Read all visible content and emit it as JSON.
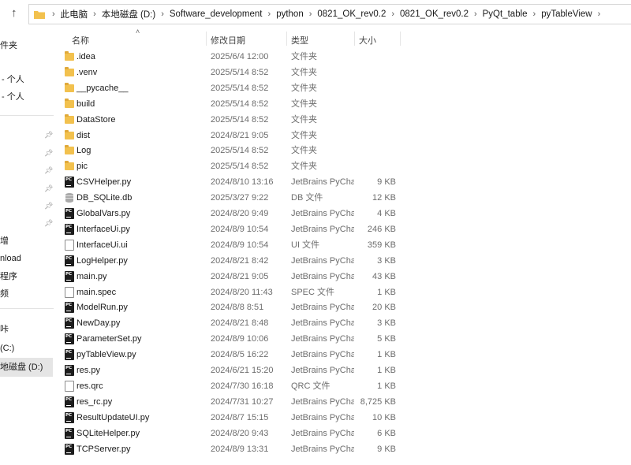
{
  "address_bar": {
    "crumbs": [
      "此电脑",
      "本地磁盘 (D:)",
      "Software_development",
      "python",
      "0821_OK_rev0.2",
      "0821_OK_rev0.2",
      "PyQt_table",
      "pyTableView"
    ]
  },
  "sidebar": {
    "items": [
      {
        "label": "件夹"
      },
      {
        "label": "- 个人"
      },
      {
        "label": "- 个人"
      },
      {
        "label": "增"
      },
      {
        "label": "nload"
      },
      {
        "label": "程序"
      },
      {
        "label": "频"
      },
      {
        "label": "咔"
      },
      {
        "label": "(C:)"
      },
      {
        "label": "地磁盘 (D:)"
      }
    ]
  },
  "columns": {
    "name": "名称",
    "date": "修改日期",
    "type": "类型",
    "size": "大小"
  },
  "files": [
    {
      "name": ".idea",
      "date": "2025/6/4 12:00",
      "type": "文件夹",
      "size": "",
      "icon": "folder"
    },
    {
      "name": ".venv",
      "date": "2025/5/14 8:52",
      "type": "文件夹",
      "size": "",
      "icon": "folder"
    },
    {
      "name": "__pycache__",
      "date": "2025/5/14 8:52",
      "type": "文件夹",
      "size": "",
      "icon": "folder"
    },
    {
      "name": "build",
      "date": "2025/5/14 8:52",
      "type": "文件夹",
      "size": "",
      "icon": "folder"
    },
    {
      "name": "DataStore",
      "date": "2025/5/14 8:52",
      "type": "文件夹",
      "size": "",
      "icon": "folder"
    },
    {
      "name": "dist",
      "date": "2024/8/21 9:05",
      "type": "文件夹",
      "size": "",
      "icon": "folder"
    },
    {
      "name": "Log",
      "date": "2025/5/14 8:52",
      "type": "文件夹",
      "size": "",
      "icon": "folder"
    },
    {
      "name": "pic",
      "date": "2025/5/14 8:52",
      "type": "文件夹",
      "size": "",
      "icon": "folder"
    },
    {
      "name": "CSVHelper.py",
      "date": "2024/8/10 13:16",
      "type": "JetBrains PyChar...",
      "size": "9 KB",
      "icon": "pycharm-file"
    },
    {
      "name": "DB_SQLite.db",
      "date": "2025/3/27 9:22",
      "type": "DB 文件",
      "size": "12 KB",
      "icon": "database-file"
    },
    {
      "name": "GlobalVars.py",
      "date": "2024/8/20 9:49",
      "type": "JetBrains PyChar...",
      "size": "4 KB",
      "icon": "pycharm-file"
    },
    {
      "name": "InterfaceUi.py",
      "date": "2024/8/9 10:54",
      "type": "JetBrains PyChar...",
      "size": "246 KB",
      "icon": "pycharm-file"
    },
    {
      "name": "InterfaceUi.ui",
      "date": "2024/8/9 10:54",
      "type": "UI 文件",
      "size": "359 KB",
      "icon": "generic-file"
    },
    {
      "name": "LogHelper.py",
      "date": "2024/8/21 8:42",
      "type": "JetBrains PyChar...",
      "size": "3 KB",
      "icon": "pycharm-file"
    },
    {
      "name": "main.py",
      "date": "2024/8/21 9:05",
      "type": "JetBrains PyChar...",
      "size": "43 KB",
      "icon": "pycharm-file"
    },
    {
      "name": "main.spec",
      "date": "2024/8/20 11:43",
      "type": "SPEC 文件",
      "size": "1 KB",
      "icon": "generic-file"
    },
    {
      "name": "ModelRun.py",
      "date": "2024/8/8 8:51",
      "type": "JetBrains PyChar...",
      "size": "20 KB",
      "icon": "pycharm-file"
    },
    {
      "name": "NewDay.py",
      "date": "2024/8/21 8:48",
      "type": "JetBrains PyChar...",
      "size": "3 KB",
      "icon": "pycharm-file"
    },
    {
      "name": "ParameterSet.py",
      "date": "2024/8/9 10:06",
      "type": "JetBrains PyChar...",
      "size": "5 KB",
      "icon": "pycharm-file"
    },
    {
      "name": "pyTableView.py",
      "date": "2024/8/5 16:22",
      "type": "JetBrains PyChar...",
      "size": "1 KB",
      "icon": "pycharm-file"
    },
    {
      "name": "res.py",
      "date": "2024/6/21 15:20",
      "type": "JetBrains PyChar...",
      "size": "1 KB",
      "icon": "pycharm-file"
    },
    {
      "name": "res.qrc",
      "date": "2024/7/30 16:18",
      "type": "QRC 文件",
      "size": "1 KB",
      "icon": "generic-file"
    },
    {
      "name": "res_rc.py",
      "date": "2024/7/31 10:27",
      "type": "JetBrains PyChar...",
      "size": "8,725 KB",
      "icon": "pycharm-file"
    },
    {
      "name": "ResultUpdateUI.py",
      "date": "2024/8/7 15:15",
      "type": "JetBrains PyChar...",
      "size": "10 KB",
      "icon": "pycharm-file"
    },
    {
      "name": "SQLiteHelper.py",
      "date": "2024/8/20 9:43",
      "type": "JetBrains PyChar...",
      "size": "6 KB",
      "icon": "pycharm-file"
    },
    {
      "name": "TCPServer.py",
      "date": "2024/8/9 13:31",
      "type": "JetBrains PyChar...",
      "size": "9 KB",
      "icon": "pycharm-file"
    }
  ]
}
